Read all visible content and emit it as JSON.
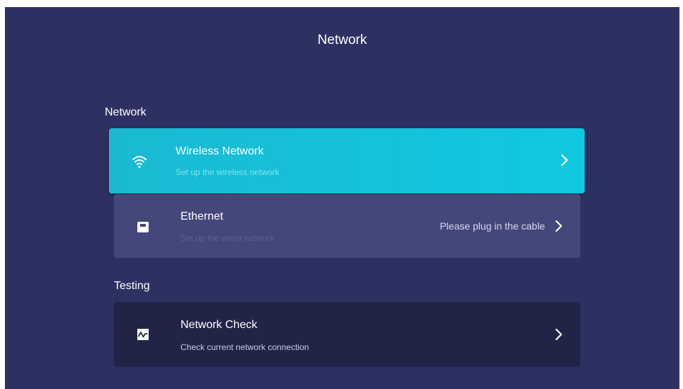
{
  "header": {
    "title": "Network"
  },
  "sections": {
    "network_label": "Network",
    "testing_label": "Testing"
  },
  "items": {
    "wireless": {
      "title": "Wireless Network",
      "subtitle": "Set up the wireless network",
      "icon": "wifi-icon"
    },
    "ethernet": {
      "title": "Ethernet",
      "subtitle": "Set up the wired network",
      "status": "Please plug in the cable",
      "icon": "ethernet-icon"
    },
    "network_check": {
      "title": "Network Check",
      "subtitle": "Check current network connection",
      "icon": "network-check-icon"
    }
  },
  "colors": {
    "background": "#2d3162",
    "selected": "#0fc9e0",
    "card": "#44477a",
    "card_dark": "#222447"
  }
}
